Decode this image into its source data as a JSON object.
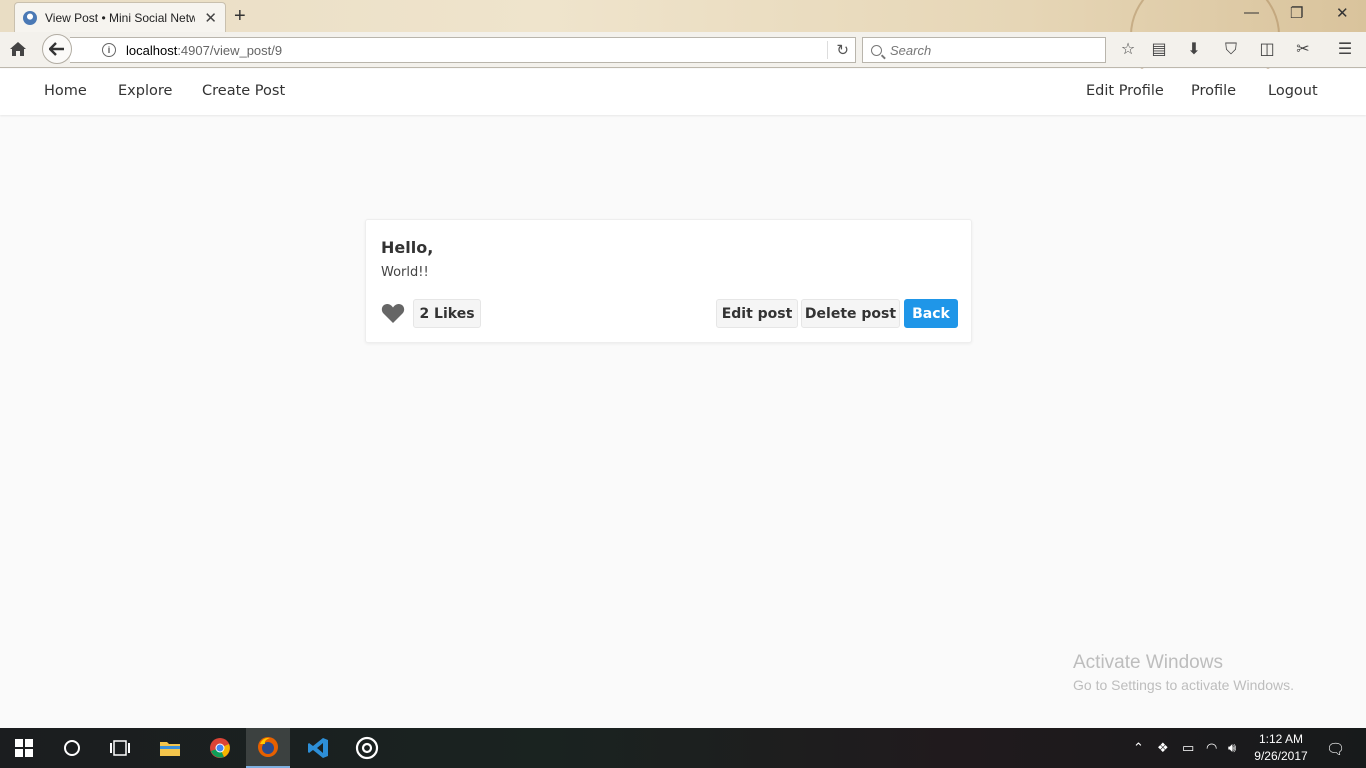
{
  "browser": {
    "tab_title": "View Post • Mini Social Netw",
    "url_host": "localhost",
    "url_path": ":4907/view_post/9",
    "search_placeholder": "Search"
  },
  "site_nav": {
    "left": [
      "Home",
      "Explore",
      "Create Post"
    ],
    "right": [
      "Edit Profile",
      "Profile",
      "Logout"
    ]
  },
  "post": {
    "title": "Hello,",
    "body": "World!!",
    "likes_label": "2 Likes",
    "edit_label": "Edit post",
    "delete_label": "Delete post",
    "back_label": "Back"
  },
  "watermark": {
    "line1": "Activate Windows",
    "line2": "Go to Settings to activate Windows."
  },
  "taskbar": {
    "time": "1:12 AM",
    "date": "9/26/2017"
  },
  "colors": {
    "primary": "#1f96e8",
    "background": "#fafafa"
  }
}
